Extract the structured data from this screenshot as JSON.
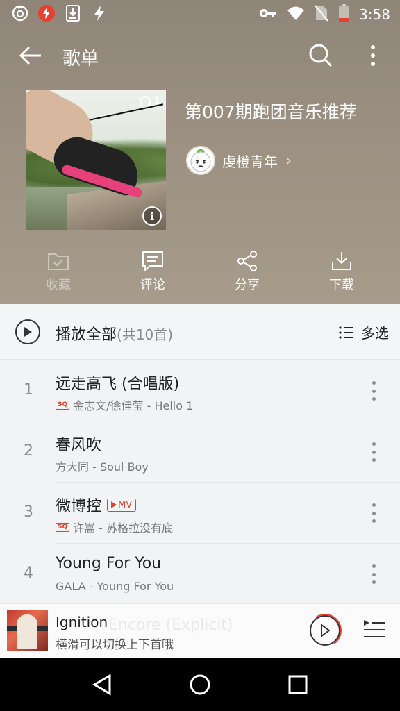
{
  "status_bar": {
    "time": "3:58",
    "left_icons": [
      "netease-music-icon",
      "flash-app-icon",
      "download-icon",
      "bolt-icon"
    ],
    "right_icons": [
      "vpn-key-icon",
      "wifi-icon",
      "no-sim-icon",
      "battery-icon"
    ],
    "battery_level": 0.25
  },
  "app_bar": {
    "title": "歌单"
  },
  "playlist": {
    "title": "第007期跑团音乐推荐",
    "play_count": "1",
    "creator": "虔橙青年"
  },
  "actions": [
    {
      "label": "收藏",
      "icon": "folder-check-icon",
      "enabled": false
    },
    {
      "label": "评论",
      "icon": "comment-icon",
      "enabled": true
    },
    {
      "label": "分享",
      "icon": "share-icon",
      "enabled": true
    },
    {
      "label": "下载",
      "icon": "download-icon",
      "enabled": true
    }
  ],
  "play_all": {
    "label": "播放全部",
    "count": "(共10首)",
    "multi_select": "多选"
  },
  "songs": [
    {
      "index": "1",
      "title": "远走高飞 (合唱版)",
      "meta": "金志文/徐佳莹 - Hello 1",
      "sq": true,
      "mv": false
    },
    {
      "index": "2",
      "title": "春风吹",
      "meta": "方大同 - Soul Boy",
      "sq": false,
      "mv": false
    },
    {
      "index": "3",
      "title": "微博控",
      "meta": "许嵩 - 苏格拉没有底",
      "sq": true,
      "mv": true,
      "mv_label": "MV"
    },
    {
      "index": "4",
      "title": "Young For You",
      "meta": "GALA - Young For You",
      "sq": false,
      "mv": false
    }
  ],
  "sq_label": "SQ",
  "mini_player": {
    "title": "Ignition",
    "subtitle": "横滑可以切换上下首哦",
    "ghost_title": "Encore (Explicit)"
  },
  "colors": {
    "accent": "#e4422f",
    "header": "#9a8f80",
    "list_bg": "#f2f3f5"
  }
}
